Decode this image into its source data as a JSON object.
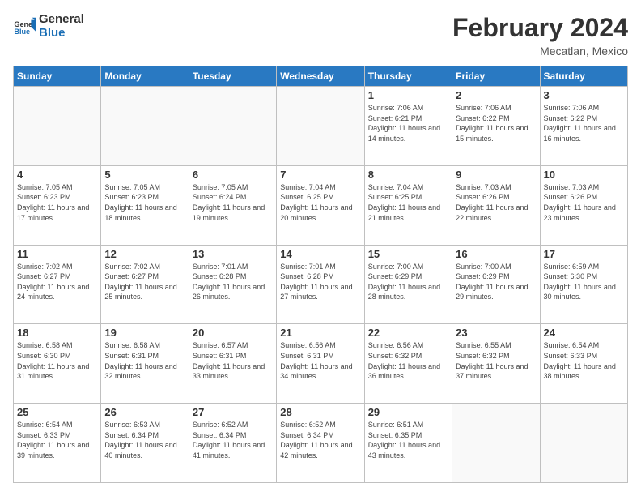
{
  "header": {
    "logo_line1": "General",
    "logo_line2": "Blue",
    "title": "February 2024",
    "subtitle": "Mecatlan, Mexico"
  },
  "weekdays": [
    "Sunday",
    "Monday",
    "Tuesday",
    "Wednesday",
    "Thursday",
    "Friday",
    "Saturday"
  ],
  "weeks": [
    [
      {
        "day": "",
        "info": ""
      },
      {
        "day": "",
        "info": ""
      },
      {
        "day": "",
        "info": ""
      },
      {
        "day": "",
        "info": ""
      },
      {
        "day": "1",
        "info": "Sunrise: 7:06 AM\nSunset: 6:21 PM\nDaylight: 11 hours and 14 minutes."
      },
      {
        "day": "2",
        "info": "Sunrise: 7:06 AM\nSunset: 6:22 PM\nDaylight: 11 hours and 15 minutes."
      },
      {
        "day": "3",
        "info": "Sunrise: 7:06 AM\nSunset: 6:22 PM\nDaylight: 11 hours and 16 minutes."
      }
    ],
    [
      {
        "day": "4",
        "info": "Sunrise: 7:05 AM\nSunset: 6:23 PM\nDaylight: 11 hours and 17 minutes."
      },
      {
        "day": "5",
        "info": "Sunrise: 7:05 AM\nSunset: 6:23 PM\nDaylight: 11 hours and 18 minutes."
      },
      {
        "day": "6",
        "info": "Sunrise: 7:05 AM\nSunset: 6:24 PM\nDaylight: 11 hours and 19 minutes."
      },
      {
        "day": "7",
        "info": "Sunrise: 7:04 AM\nSunset: 6:25 PM\nDaylight: 11 hours and 20 minutes."
      },
      {
        "day": "8",
        "info": "Sunrise: 7:04 AM\nSunset: 6:25 PM\nDaylight: 11 hours and 21 minutes."
      },
      {
        "day": "9",
        "info": "Sunrise: 7:03 AM\nSunset: 6:26 PM\nDaylight: 11 hours and 22 minutes."
      },
      {
        "day": "10",
        "info": "Sunrise: 7:03 AM\nSunset: 6:26 PM\nDaylight: 11 hours and 23 minutes."
      }
    ],
    [
      {
        "day": "11",
        "info": "Sunrise: 7:02 AM\nSunset: 6:27 PM\nDaylight: 11 hours and 24 minutes."
      },
      {
        "day": "12",
        "info": "Sunrise: 7:02 AM\nSunset: 6:27 PM\nDaylight: 11 hours and 25 minutes."
      },
      {
        "day": "13",
        "info": "Sunrise: 7:01 AM\nSunset: 6:28 PM\nDaylight: 11 hours and 26 minutes."
      },
      {
        "day": "14",
        "info": "Sunrise: 7:01 AM\nSunset: 6:28 PM\nDaylight: 11 hours and 27 minutes."
      },
      {
        "day": "15",
        "info": "Sunrise: 7:00 AM\nSunset: 6:29 PM\nDaylight: 11 hours and 28 minutes."
      },
      {
        "day": "16",
        "info": "Sunrise: 7:00 AM\nSunset: 6:29 PM\nDaylight: 11 hours and 29 minutes."
      },
      {
        "day": "17",
        "info": "Sunrise: 6:59 AM\nSunset: 6:30 PM\nDaylight: 11 hours and 30 minutes."
      }
    ],
    [
      {
        "day": "18",
        "info": "Sunrise: 6:58 AM\nSunset: 6:30 PM\nDaylight: 11 hours and 31 minutes."
      },
      {
        "day": "19",
        "info": "Sunrise: 6:58 AM\nSunset: 6:31 PM\nDaylight: 11 hours and 32 minutes."
      },
      {
        "day": "20",
        "info": "Sunrise: 6:57 AM\nSunset: 6:31 PM\nDaylight: 11 hours and 33 minutes."
      },
      {
        "day": "21",
        "info": "Sunrise: 6:56 AM\nSunset: 6:31 PM\nDaylight: 11 hours and 34 minutes."
      },
      {
        "day": "22",
        "info": "Sunrise: 6:56 AM\nSunset: 6:32 PM\nDaylight: 11 hours and 36 minutes."
      },
      {
        "day": "23",
        "info": "Sunrise: 6:55 AM\nSunset: 6:32 PM\nDaylight: 11 hours and 37 minutes."
      },
      {
        "day": "24",
        "info": "Sunrise: 6:54 AM\nSunset: 6:33 PM\nDaylight: 11 hours and 38 minutes."
      }
    ],
    [
      {
        "day": "25",
        "info": "Sunrise: 6:54 AM\nSunset: 6:33 PM\nDaylight: 11 hours and 39 minutes."
      },
      {
        "day": "26",
        "info": "Sunrise: 6:53 AM\nSunset: 6:34 PM\nDaylight: 11 hours and 40 minutes."
      },
      {
        "day": "27",
        "info": "Sunrise: 6:52 AM\nSunset: 6:34 PM\nDaylight: 11 hours and 41 minutes."
      },
      {
        "day": "28",
        "info": "Sunrise: 6:52 AM\nSunset: 6:34 PM\nDaylight: 11 hours and 42 minutes."
      },
      {
        "day": "29",
        "info": "Sunrise: 6:51 AM\nSunset: 6:35 PM\nDaylight: 11 hours and 43 minutes."
      },
      {
        "day": "",
        "info": ""
      },
      {
        "day": "",
        "info": ""
      }
    ]
  ]
}
